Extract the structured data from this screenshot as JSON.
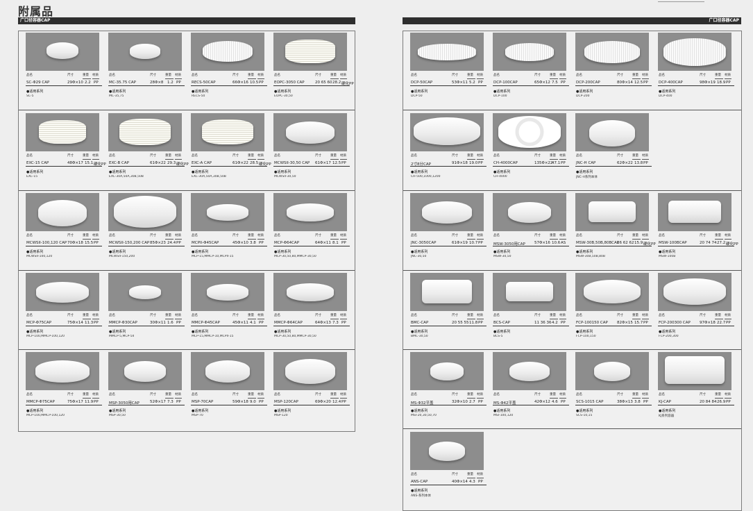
{
  "page": {
    "title": "附属品"
  },
  "left_section": {
    "label": "广口径容器CAP"
  },
  "right_section": {
    "label": "广口径容器CAP"
  },
  "labels": {
    "name": "品名",
    "size": "尺寸",
    "weight": "重量",
    "material": "材质",
    "series": "●适用系列"
  },
  "left_products": [
    {
      "name": "SC-Φ29 CAP",
      "size": "29Φ×10",
      "weight": "2.2",
      "material": "PP",
      "series": "SC-5"
    },
    {
      "name": "MC-35.75 CAP",
      "size": "28Φ×8",
      "weight": "1.2",
      "material": "PP",
      "series": "MC-35,75"
    },
    {
      "name": "RECS-50CAP",
      "size": "66Φ×16",
      "weight": "10.5",
      "material": "PP",
      "series": "RECS-50"
    },
    {
      "name": "EOPC-3050 CAP",
      "size": "20 65 60",
      "weight": "28.2",
      "material": "硬化PP",
      "series": "EOPC-30,50"
    },
    {
      "name": "EXC-15 CAP",
      "size": "48Φ×17",
      "weight": "15.1",
      "material": "硬化PP",
      "series": "EXC-15"
    },
    {
      "name": "EXC-B CAP",
      "size": "61Φ×22",
      "weight": "29.3",
      "material": "硬化PP",
      "series": "EXC-30A,50A,30B,50B"
    },
    {
      "name": "EXC-A CAP",
      "size": "61Φ×22",
      "weight": "28.5",
      "material": "硬化PP",
      "series": "EXC-30A,50A,30B,50B"
    },
    {
      "name": "MCWSII-30,50 CAP",
      "size": "61Φ×17",
      "weight": "12.5",
      "material": "PP",
      "series": "MCWSII-30,50"
    },
    {
      "name": "MCWSII-100,120 CAP",
      "size": "70Φ×18",
      "weight": "15.5",
      "material": "PP",
      "series": "MCWSII-100,120"
    },
    {
      "name": "MCWSII-150,200 CAP",
      "size": "85Φ×23",
      "weight": "24.4",
      "material": "PP",
      "series": "MCWSII-150,200"
    },
    {
      "name": "MCPII-Φ45CAP",
      "size": "45Φ×10",
      "weight": "3.8",
      "material": "PP",
      "series": "MCP-15,MMCP-10,MCPII-15"
    },
    {
      "name": "MCP-Φ64CAP",
      "size": "64Φ×11",
      "weight": "8.1",
      "material": "PP",
      "series": "MCP-30,50,80,MMCP-30,50"
    },
    {
      "name": "MCP-Φ75CAP",
      "size": "75Φ×14",
      "weight": "11.3",
      "material": "PP",
      "series": "MCP-100,MMCP-100,120"
    },
    {
      "name": "MMCP-Φ30CAP",
      "size": "30Φ×11",
      "weight": "1.6",
      "material": "PP",
      "series": "MMCP-5,MCP-5II"
    },
    {
      "name": "MMCP-Φ45CAP",
      "size": "45Φ×11",
      "weight": "4.1",
      "material": "PP",
      "series": "MCP-15,MMCP-10,MCPII-15"
    },
    {
      "name": "MMCP-Φ64CAP",
      "size": "64Φ×13",
      "weight": "7.3",
      "material": "PP",
      "series": "MCP-30,50,80,MMCP-30,50"
    },
    {
      "name": "MMCP-Φ75CAP",
      "size": "75Φ×17",
      "weight": "11.9",
      "material": "PP",
      "series": "MCP-100,MMCP-100,120"
    },
    {
      "name": "MSP-3050用CAP",
      "size": "52Φ×17",
      "weight": "7.3",
      "material": "PP",
      "series": "MSP-30,50"
    },
    {
      "name": "MSP-70CAP",
      "size": "59Φ×18",
      "weight": "9.0",
      "material": "PP",
      "series": "MSP-70"
    },
    {
      "name": "MSP-120CAP",
      "size": "69Φ×20",
      "weight": "12.4",
      "material": "PP",
      "series": "MSP-120"
    }
  ],
  "right_products": [
    {
      "name": "DCP-50CAP",
      "size": "53Φ×11",
      "weight": "5.2",
      "material": "PP",
      "series": "DCP-50"
    },
    {
      "name": "DCP-100CAP",
      "size": "65Φ×12",
      "weight": "7.5",
      "material": "PP",
      "series": "DCP-100"
    },
    {
      "name": "DCP-200CAP",
      "size": "80Φ×14",
      "weight": "12.5",
      "material": "PP",
      "series": "DCP-200"
    },
    {
      "name": "DCP-400CAP",
      "size": "98Φ×19",
      "weight": "18.9",
      "material": "PP",
      "series": "DCP-400"
    },
    {
      "name": "2寸8分CAP",
      "size": "91Φ×18",
      "weight": "19.0",
      "material": "PP",
      "series": "CH-500,1000,1200"
    },
    {
      "name": "CH-4000CAP",
      "size": "135Φ×22",
      "weight": "47.1",
      "material": "PP",
      "series": "CH-4000"
    },
    {
      "name": "JNC-H CAP",
      "size": "62Φ×22",
      "weight": "13.8",
      "material": "PP",
      "series": "JNC-H系列本体"
    },
    {
      "name": "JNC-3050CAP",
      "size": "61Φ×19",
      "weight": "10.7",
      "material": "PP",
      "series": "JNC-30,50"
    },
    {
      "name": "MSW-3050用CAP",
      "size": "57Φ×16",
      "weight": "10.6",
      "material": "AS",
      "series": "MSW-30,50"
    },
    {
      "name": "MSW-30B,50B,80BCAP",
      "size": "16 62 62",
      "weight": "15.9",
      "material": "硬化PP",
      "series": "MSW-30B,50B,80B"
    },
    {
      "name": "MSW-100BCAP",
      "size": "20 74 74",
      "weight": "27.2",
      "material": "硬化PP",
      "series": "MSW-100B"
    },
    {
      "name": "BMC-CAP",
      "size": "20 55 55",
      "weight": "11.8",
      "material": "PP",
      "series": "BMC-30,50"
    },
    {
      "name": "BCS-CAP",
      "size": "11 36 36",
      "weight": "4.2",
      "material": "PP",
      "series": "BCS-5"
    },
    {
      "name": "FCP-100150 CAP",
      "size": "82Φ×15",
      "weight": "15.7",
      "material": "PP",
      "series": "FCP-100,150"
    },
    {
      "name": "FCP-200300 CAP",
      "size": "97Φ×18",
      "weight": "22.7",
      "material": "PP",
      "series": "FCP-200,300"
    },
    {
      "name": "MS-Φ32平盖",
      "size": "32Φ×10",
      "weight": "2.7",
      "material": "PP",
      "series": "MSI-20,30,50,70"
    },
    {
      "name": "MS-Φ42平盖",
      "size": "42Φ×12",
      "weight": "4.6",
      "material": "PP",
      "series": "MSI-100,120"
    },
    {
      "name": "SCS-1015 CAP",
      "size": "38Φ×13",
      "weight": "3.8",
      "material": "PP",
      "series": "SCS-10,15"
    },
    {
      "name": "KJ-CAP",
      "size": "20 84 84",
      "weight": "26.9",
      "material": "PP",
      "series": "KJ系列容器"
    },
    {
      "name": "ANS-CAP",
      "size": "40Φ×14",
      "weight": "4.3",
      "material": "PP",
      "series": "ANS-系列本体"
    }
  ]
}
